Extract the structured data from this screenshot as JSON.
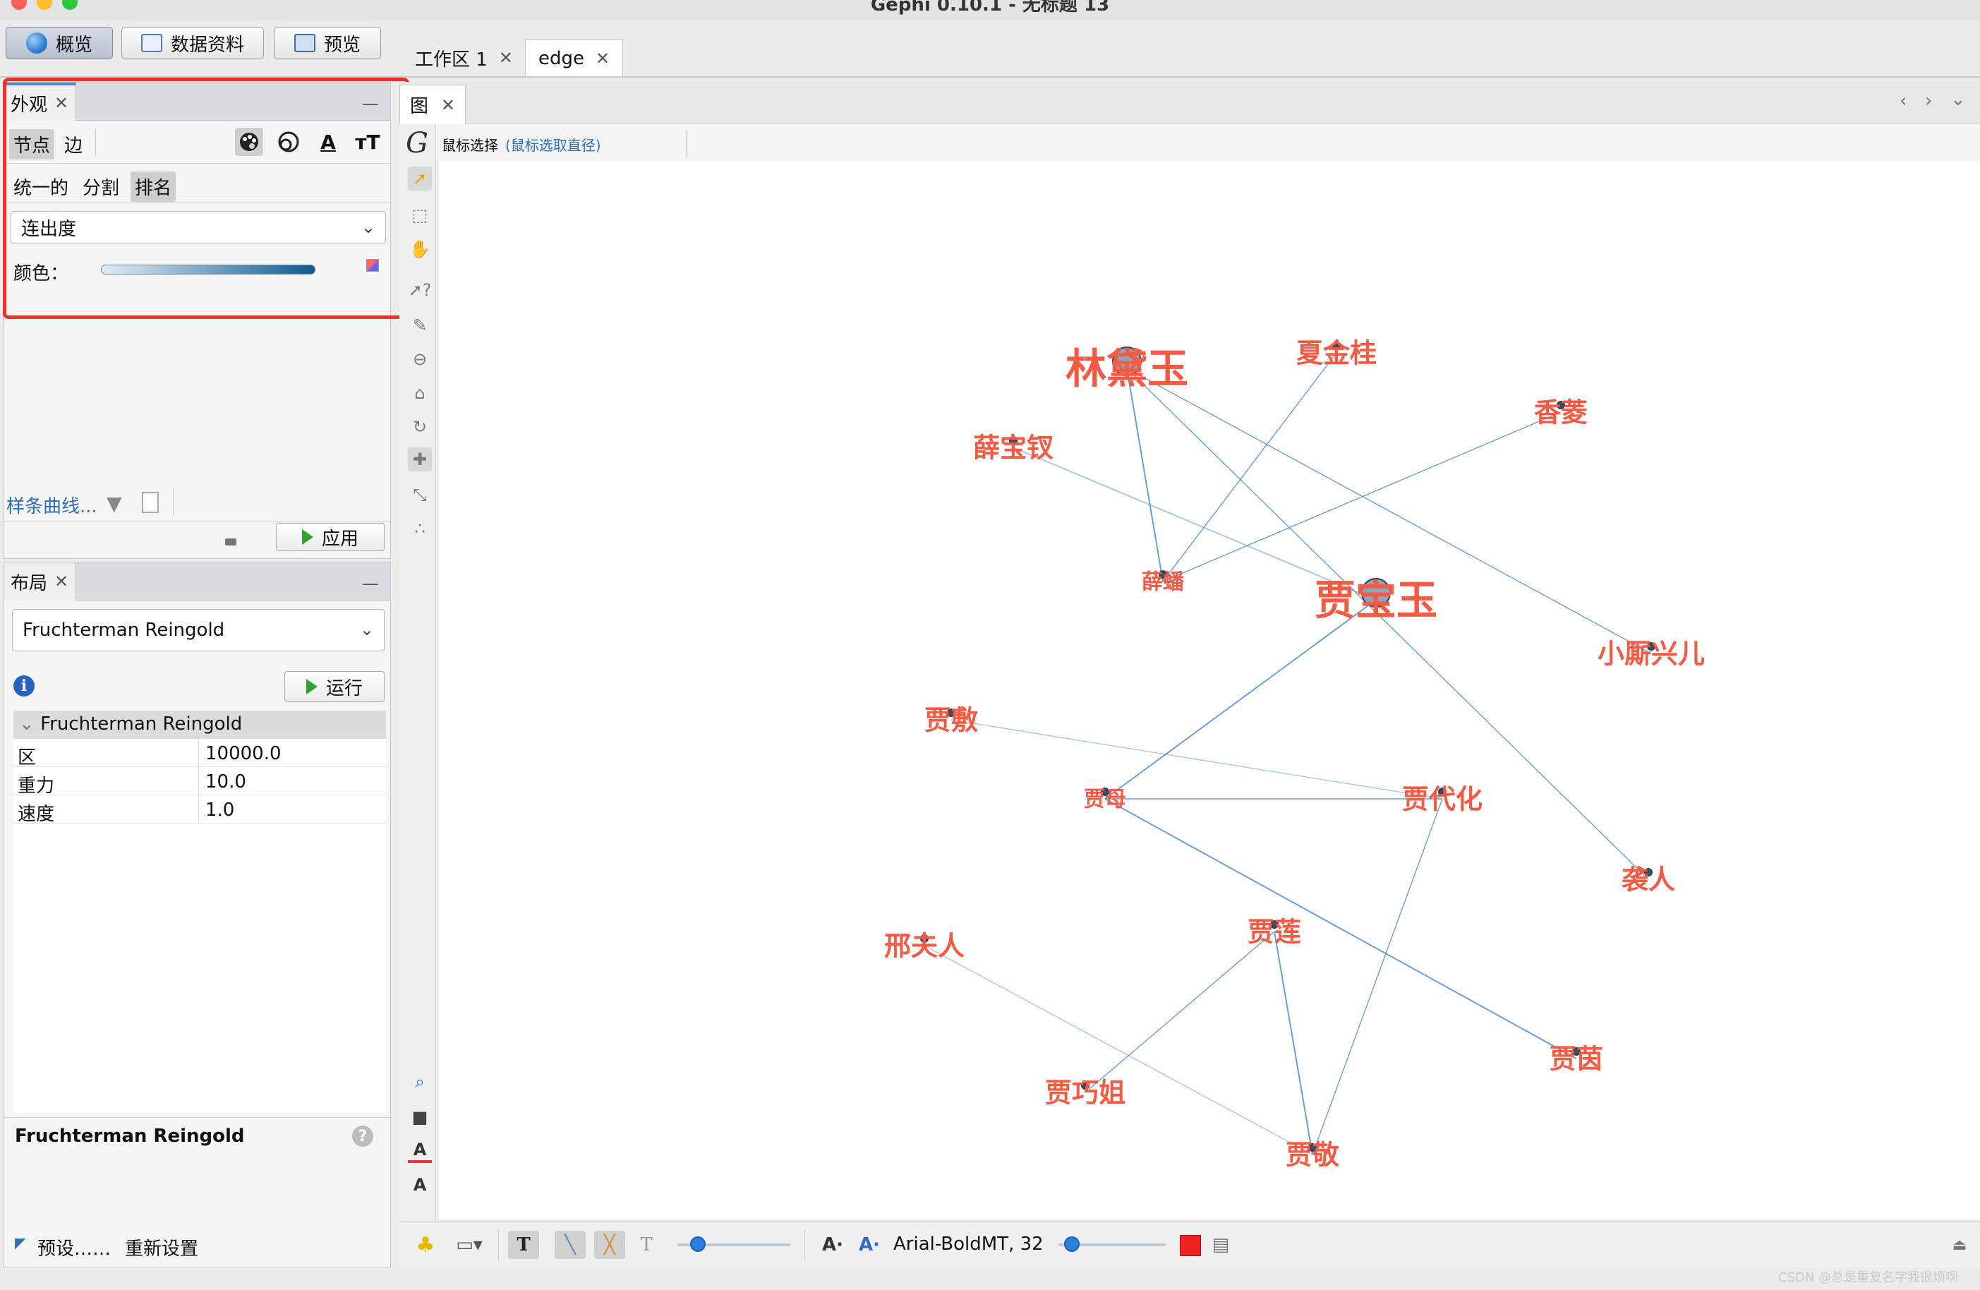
{
  "window": {
    "title": "Gephi 0.10.1 - 无标题 13"
  },
  "toolbar": {
    "overview": "概览",
    "data_lab": "数据资料",
    "preview": "预览"
  },
  "workspaces": {
    "tab1": "工作区 1",
    "tab2": "edge"
  },
  "appearance": {
    "title": "外观",
    "nodes_tab": "节点",
    "edges_tab": "边",
    "modes": [
      "统一的",
      "分割",
      "排名"
    ],
    "attribute": "连出度",
    "color_label": "颜色：",
    "spline_link": "样条曲线...",
    "apply": "应用",
    "gradient_start": "#e3edf6",
    "gradient_end": "#0f5b8e"
  },
  "layout": {
    "title": "布局",
    "algorithm": "Fruchterman Reingold",
    "run": "运行",
    "section": "Fruchterman Reingold",
    "props": [
      {
        "key": "区",
        "value": "10000.0"
      },
      {
        "key": "重力",
        "value": "10.0"
      },
      {
        "key": "速度",
        "value": "1.0"
      }
    ],
    "description_title": "Fruchterman Reingold",
    "presets": "预设……",
    "reset": "重新设置"
  },
  "graph_window": {
    "tab": "图",
    "selection_mode": "鼠标选择",
    "selection_hint": "(鼠标选取直径)"
  },
  "graph": {
    "label_color": "#f35b44",
    "edge_color": "#4a86c5",
    "nodes": [
      {
        "id": "lin",
        "label": "林黛玉",
        "size": "large"
      },
      {
        "id": "xia",
        "label": "夏金桂",
        "size": "medium"
      },
      {
        "id": "xiangling",
        "label": "香菱",
        "size": "medium"
      },
      {
        "id": "xuebc",
        "label": "薛宝钗",
        "size": "medium"
      },
      {
        "id": "xuepan",
        "label": "薛蟠",
        "size": "small"
      },
      {
        "id": "baoyu",
        "label": "贾宝玉",
        "size": "large"
      },
      {
        "id": "xingr",
        "label": "小厮兴儿",
        "size": "medium"
      },
      {
        "id": "jiashe",
        "label": "贾敷",
        "size": "medium"
      },
      {
        "id": "jiamu",
        "label": "贾母",
        "size": "small"
      },
      {
        "id": "jiadaihua",
        "label": "贾代化",
        "size": "medium"
      },
      {
        "id": "xiren",
        "label": "袭人",
        "size": "medium"
      },
      {
        "id": "xing",
        "label": "邢夫人",
        "size": "medium"
      },
      {
        "id": "jialian",
        "label": "贾莲",
        "size": "medium"
      },
      {
        "id": "jiayin",
        "label": "贾茵",
        "size": "medium"
      },
      {
        "id": "qiaojie",
        "label": "贾巧姐",
        "size": "medium"
      },
      {
        "id": "jiajing",
        "label": "贾敬",
        "size": "medium"
      }
    ],
    "edges": [
      [
        "lin",
        "xuepan"
      ],
      [
        "xia",
        "xuepan"
      ],
      [
        "xiangling",
        "xuepan"
      ],
      [
        "xuebc",
        "baoyu"
      ],
      [
        "lin",
        "xingr"
      ],
      [
        "lin",
        "xiren"
      ],
      [
        "baoyu",
        "jiamu"
      ],
      [
        "jiashe",
        "jiadaihua"
      ],
      [
        "jiamu",
        "jiadaihua"
      ],
      [
        "jiamu",
        "jiayin"
      ],
      [
        "jiadaihua",
        "jiajing"
      ],
      [
        "xing",
        "jiajing"
      ],
      [
        "jialian",
        "jiajing"
      ],
      [
        "jialian",
        "qiaojie"
      ]
    ]
  },
  "bottom_bar": {
    "font_label": "Arial-BoldMT, 32",
    "color_swatch": "#ee2222"
  },
  "watermark": "CSDN @总是重复名字我很烦啊"
}
